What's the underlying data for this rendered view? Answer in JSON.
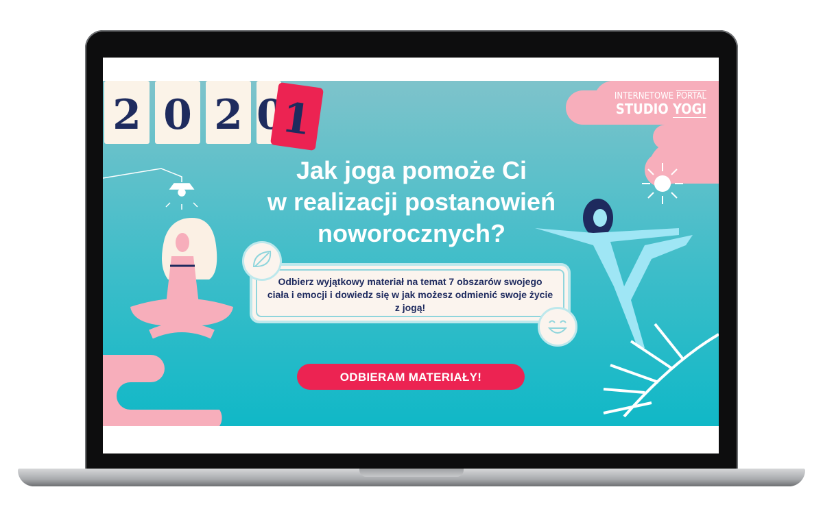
{
  "banner": {
    "year_digits": [
      "2",
      "0",
      "2",
      "0",
      "1"
    ],
    "logo": {
      "line1_left": "INTERNETOWE",
      "line1_right": "PORTAL",
      "line2_left": "STUDIO",
      "line2_right": "YOGI"
    },
    "title_lines": [
      "Jak joga pomoże Ci",
      "w realizacji postanowień",
      "noworocznych?"
    ],
    "description": "Odbierz wyjątkowy materiał na temat 7 obszarów swojego ciała i emocji i dowiedz się w jak możesz odmienić swoje życie z jogą!",
    "cta_label": "ODBIERAM MATERIAŁY!"
  },
  "colors": {
    "teal": "#3dbdc9",
    "pink": "#f7aebb",
    "cta": "#ec2352",
    "navy": "#1e2a5e",
    "cream": "#fbf3e8"
  }
}
